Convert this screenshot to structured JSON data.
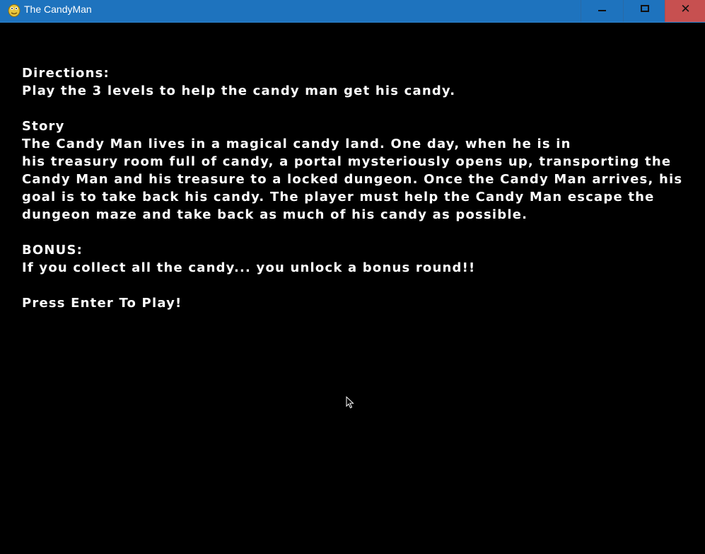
{
  "window": {
    "title": "The CandyMan",
    "controls": {
      "minimize_icon": "minimize-icon",
      "maximize_icon": "maximize-icon",
      "close_symbol": "✕"
    },
    "colors": {
      "titlebar": "#1e73be",
      "close": "#c75050",
      "background": "#000000",
      "text": "#ffffff"
    }
  },
  "screen": {
    "directions_heading": "Directions:",
    "directions_text": "Play the 3 levels to help the candy man get his candy.",
    "story_heading": "Story",
    "story_lines": [
      "The Candy Man lives in a magical candy land. One day, when he is in",
      "his treasury room full of candy, a portal mysteriously opens up, transporting the",
      "Candy Man and his treasure to a locked dungeon. Once the Candy Man arrives, his",
      "goal is to take back his candy. The player must help the Candy Man escape the",
      "dungeon maze and take back as much of his candy as possible."
    ],
    "bonus_heading": "BONUS:",
    "bonus_text": "If you collect all the candy... you unlock a bonus round!!",
    "prompt": "Press Enter To Play!"
  }
}
